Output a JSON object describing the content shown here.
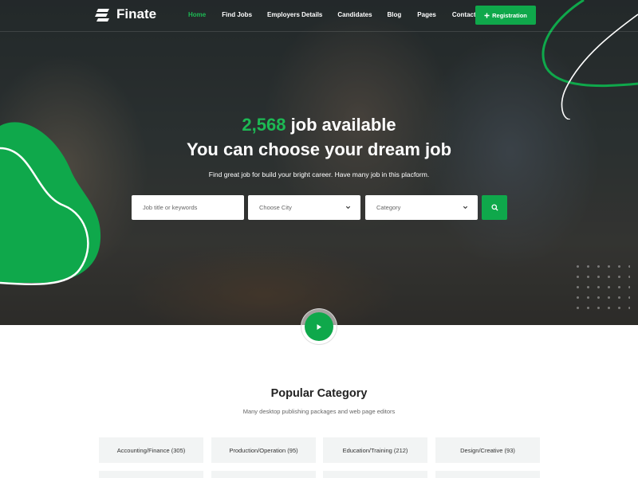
{
  "brand": {
    "name": "Finate",
    "accent": "#0fa84b"
  },
  "nav": {
    "items": [
      {
        "label": "Home",
        "active": true
      },
      {
        "label": "Find Jobs",
        "active": false
      },
      {
        "label": "Employers Details",
        "active": false
      },
      {
        "label": "Candidates",
        "active": false
      },
      {
        "label": "Blog",
        "active": false
      },
      {
        "label": "Pages",
        "active": false
      },
      {
        "label": "Contact",
        "active": false
      }
    ],
    "cta_label": "Registration",
    "cta_icon": "plus-icon"
  },
  "hero": {
    "job_count": "2,568",
    "headline_suffix": "job available",
    "headline2": "You can choose your dream job",
    "subtext": "Find great job for build your bright career. Have many job in this placform."
  },
  "search": {
    "keyword_placeholder": "Job title or keywords",
    "city_selected": "Choose City",
    "category_selected": "Category",
    "button_icon": "search-icon"
  },
  "video": {
    "icon": "play-icon"
  },
  "categories": {
    "title": "Popular Category",
    "subtitle": "Many desktop publishing packages and web page editors",
    "items": [
      {
        "label": "Accounting/Finance (305)"
      },
      {
        "label": "Production/Operation (95)"
      },
      {
        "label": "Education/Training (212)"
      },
      {
        "label": "Design/Creative (93)"
      }
    ]
  }
}
